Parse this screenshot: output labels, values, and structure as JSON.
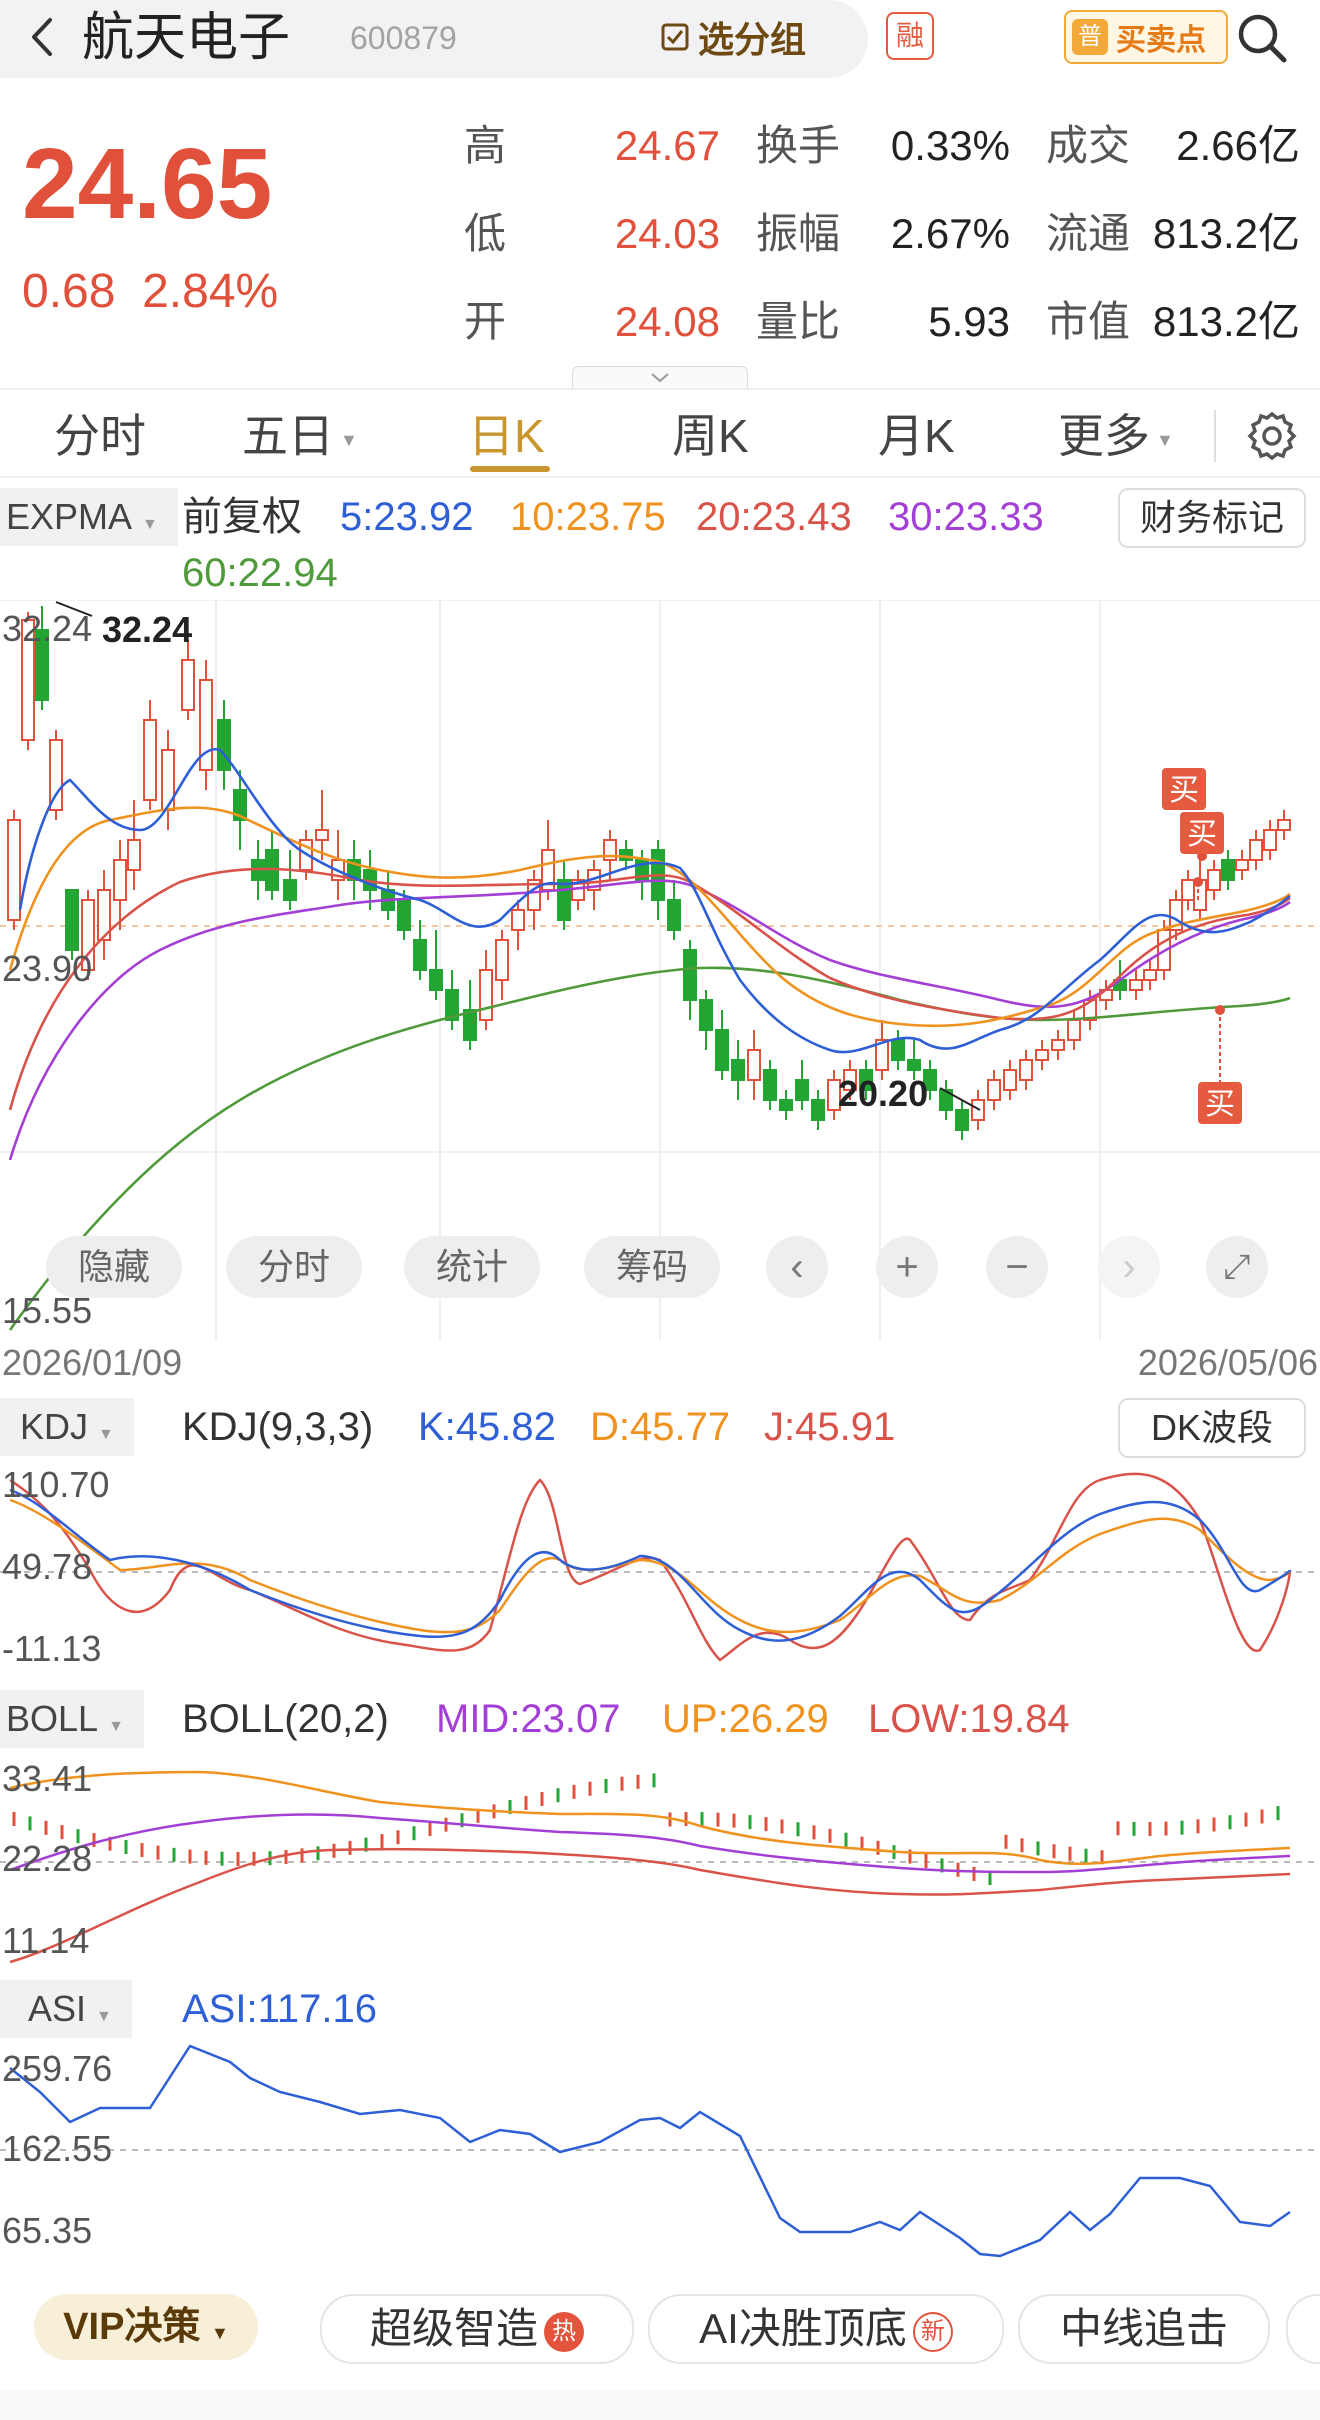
{
  "header": {
    "stock_name": "航天电子",
    "stock_code": "600879",
    "select_group": "选分组",
    "margin_badge": "融",
    "buy_sell_badge": "普",
    "buy_sell_label": "买卖点"
  },
  "quote": {
    "price": "24.65",
    "change": "0.68",
    "change_pct": "2.84%",
    "rows": [
      {
        "l1": "高",
        "v1": "24.67",
        "l2": "换手",
        "v2": "0.33%",
        "l3": "成交",
        "v3": "2.66亿"
      },
      {
        "l1": "低",
        "v1": "24.03",
        "l2": "振幅",
        "v2": "2.67%",
        "l3": "流通",
        "v3": "813.2亿"
      },
      {
        "l1": "开",
        "v1": "24.08",
        "l2": "量比",
        "v2": "5.93",
        "l3": "市值",
        "v3": "813.2亿"
      }
    ]
  },
  "tabs": [
    "分时",
    "五日",
    "日K",
    "周K",
    "月K",
    "更多"
  ],
  "active_tab": "日K",
  "colors": {
    "up": "#e0503a",
    "down": "#22a532",
    "ema5": "#2e5fd6",
    "ema10": "#f0921e",
    "ema20": "#d9534a",
    "ema30": "#a43fd6",
    "ema60": "#4f9a3a",
    "accent_gold": "#c9962e"
  },
  "main_chart": {
    "indicator": "EXPMA",
    "adjust": "前复权",
    "ema_labels": [
      "5:23.92",
      "10:23.75",
      "20:23.43",
      "30:23.33",
      "60:22.94"
    ],
    "finance_mark": "财务标记",
    "y_top": "32.24",
    "y_mid": "23.90",
    "y_bottom": "15.55",
    "high_mark": "32.24",
    "low_mark": "20.20",
    "buy_labels": [
      "买",
      "买",
      "买"
    ],
    "date_start": "2026/01/09",
    "date_end": "2026/05/06",
    "buttons": [
      "隐藏",
      "分时",
      "统计",
      "筹码"
    ]
  },
  "kdj": {
    "tag": "KDJ",
    "params": "KDJ(9,3,3)",
    "k": "K:45.82",
    "d": "D:45.77",
    "j": "J:45.91",
    "right_button": "DK波段",
    "y_top": "110.70",
    "y_mid": "49.78",
    "y_bottom": "-11.13"
  },
  "boll": {
    "tag": "BOLL",
    "params": "BOLL(20,2)",
    "mid": "MID:23.07",
    "up": "UP:26.29",
    "low": "LOW:19.84",
    "y_top": "33.41",
    "y_mid": "22.28",
    "y_bottom": "11.14"
  },
  "asi": {
    "tag": "ASI",
    "value": "ASI:117.16",
    "y_top": "259.76",
    "y_mid": "162.55",
    "y_bottom": "65.35"
  },
  "bottom": {
    "vip": "VIP决策",
    "features": [
      {
        "label": "超级智造",
        "badge": "热"
      },
      {
        "label": "AI决胜顶底",
        "badge": "新"
      },
      {
        "label": "中线追击",
        "badge": ""
      }
    ]
  }
}
